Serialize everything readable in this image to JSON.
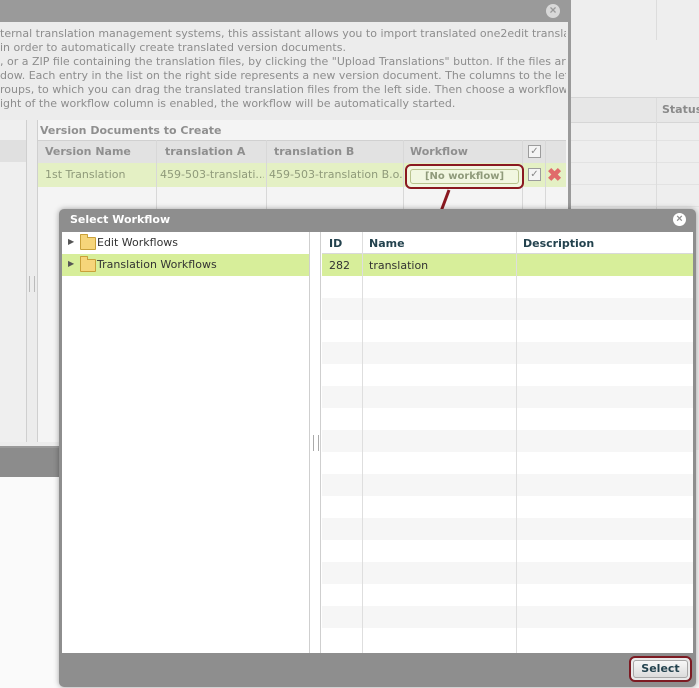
{
  "background": {
    "status_column_label": "Status"
  },
  "import_dialog": {
    "close_symbol": "×",
    "intro_lines": [
      "ternal translation management systems, this assistant allows you to import translated one2edit translation",
      "in order to automatically create translated version documents.",
      ", or a ZIP file containing the translation files, by clicking the \"Upload Translations\" button. If the files are valid,",
      "dow. Each entry in the list on the right side represents a new version document. The columns to the left of the",
      "roups, to which you can drag the translated translation files from the left side. Then choose a workflow for the",
      "ight of the workflow column is enabled, the workflow will be automatically started."
    ],
    "version_documents": {
      "title": "Version Documents to Create",
      "columns": [
        "Version Name",
        "translation A",
        "translation B",
        "Workflow"
      ],
      "rows": [
        {
          "version_name": "1st Translation",
          "translation_a": "459-503-translati...",
          "translation_b": "459-503-translation B.o...",
          "workflow": "[No workflow]"
        }
      ]
    }
  },
  "select_workflow_dialog": {
    "title": "Select Workflow",
    "close_symbol": "×",
    "tree": [
      {
        "label": "Edit Workflows",
        "selected": false
      },
      {
        "label": "Translation Workflows",
        "selected": true
      }
    ],
    "grid": {
      "columns": [
        "ID",
        "Name",
        "Description"
      ],
      "rows": [
        {
          "id": "282",
          "name": "translation",
          "description": ""
        }
      ]
    },
    "select_button_label": "Select"
  },
  "colors": {
    "highlight_red": "#8a1820",
    "selected_row": "#d7ee9a",
    "header_text": "#23424e"
  }
}
